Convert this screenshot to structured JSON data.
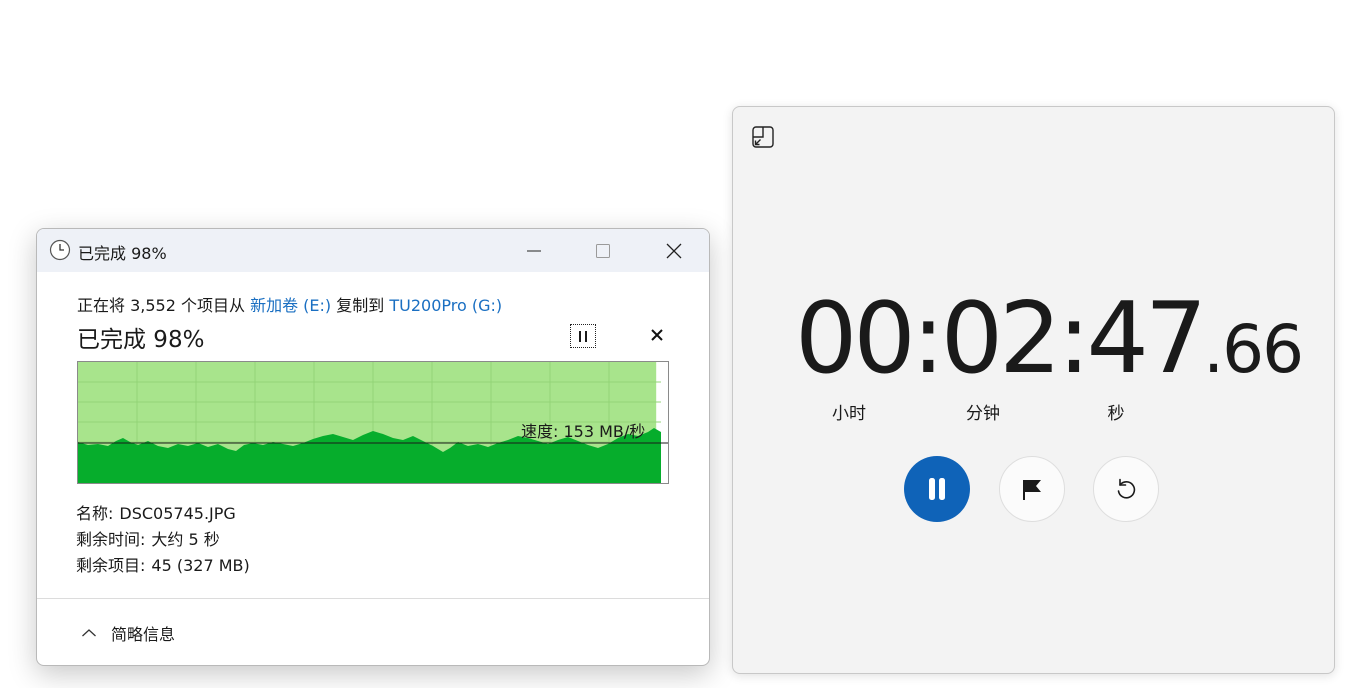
{
  "copy_dialog": {
    "title": "已完成 98%",
    "summary_prefix": "正在将 3,552 个项目从 ",
    "source": "新加卷 (E:)",
    "summary_mid": " 复制到 ",
    "destination": "TU200Pro (G:)",
    "progress_text": "已完成 98%",
    "progress_percent": 98,
    "speed_label": "速度: 153 MB/秒",
    "details": [
      {
        "label": "名称:",
        "value": "DSC05745.JPG"
      },
      {
        "label": "剩余时间:",
        "value": "大约 5 秒"
      },
      {
        "label": "剩余项目:",
        "value": "45 (327 MB)"
      }
    ],
    "less_details_label": "简略信息",
    "colors": {
      "graph_fill": "#a8e48c",
      "speed_fill": "#06ad2c",
      "link": "#1a6fc2"
    },
    "icons": {
      "title": "clock-icon",
      "minimize": "minimize-icon",
      "maximize": "maximize-icon",
      "close": "close-icon",
      "pause": "pause-icon",
      "cancel": "cancel-icon",
      "chevron": "chevron-up-icon"
    }
  },
  "stopwatch": {
    "hours": "00",
    "minutes": "02",
    "seconds": "47",
    "centiseconds": "66",
    "units": {
      "hours": "小时",
      "minutes": "分钟",
      "seconds": "秒"
    },
    "colors": {
      "primary_button": "#0f63b8"
    },
    "icons": {
      "compact": "compact-overlay-icon",
      "pause": "pause-icon",
      "lap": "flag-icon",
      "reset": "reset-icon"
    }
  }
}
